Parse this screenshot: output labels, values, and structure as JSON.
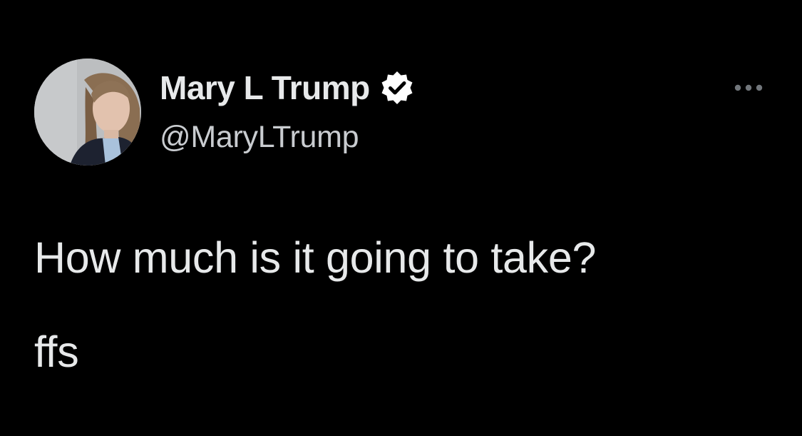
{
  "tweet": {
    "author": {
      "display_name": "Mary L Trump",
      "handle": "@MaryLTrump",
      "verified": true,
      "verified_icon": "verified-badge-icon",
      "avatar_icon": "profile-photo"
    },
    "more_icon": "more-options-icon",
    "text_lines": [
      "How much is it going to take?",
      "ffs"
    ]
  },
  "colors": {
    "background": "#000000",
    "primary_text": "#e7e9ea",
    "secondary_text": "#c9ccd0",
    "badge": "#ffffff"
  }
}
